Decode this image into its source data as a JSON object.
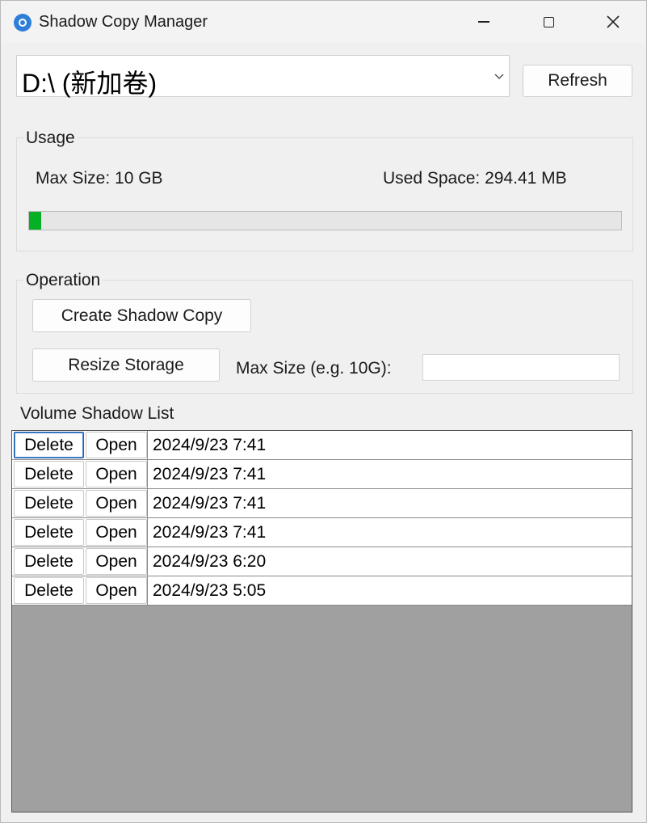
{
  "window": {
    "title": "Shadow Copy Manager"
  },
  "drive": {
    "selected": "D:\\ (新加卷)"
  },
  "toolbar": {
    "refresh_label": "Refresh"
  },
  "usage": {
    "title": "Usage",
    "max_size_text": "Max Size: 10 GB",
    "used_space_text": "Used Space: 294.41 MB",
    "progress_percent": 2,
    "progress_color": "#06b025"
  },
  "operation": {
    "title": "Operation",
    "create_label": "Create Shadow Copy",
    "resize_label": "Resize Storage",
    "max_size_label": "Max Size (e.g. 10G):",
    "max_size_value": ""
  },
  "list": {
    "title": "Volume Shadow List",
    "delete_label": "Delete",
    "open_label": "Open",
    "rows": [
      {
        "date": "2024/9/23 7:41"
      },
      {
        "date": "2024/9/23 7:41"
      },
      {
        "date": "2024/9/23 7:41"
      },
      {
        "date": "2024/9/23 7:41"
      },
      {
        "date": "2024/9/23 6:20"
      },
      {
        "date": "2024/9/23 5:05"
      }
    ]
  }
}
